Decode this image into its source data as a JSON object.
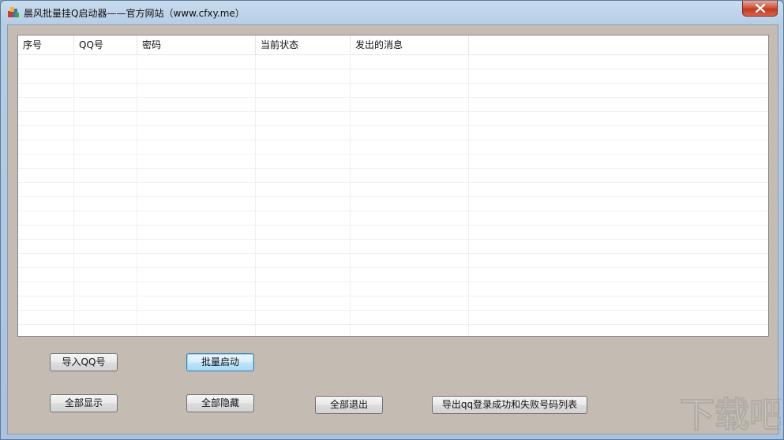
{
  "window": {
    "title": "晨风批量挂Q启动器——官方网站（www.cfxy.me）",
    "colors": {
      "client_bg": "#c4bcb2",
      "close_red": "#c23a20"
    }
  },
  "listview": {
    "columns": [
      "序号",
      "QQ号",
      "密码",
      "当前状态",
      "发出的消息",
      ""
    ],
    "rows": []
  },
  "buttons": {
    "import_qq": "导入QQ号",
    "batch_start": "批量启动",
    "show_all": "全部显示",
    "hide_all": "全部隐藏",
    "exit_all": "全部退出",
    "export_list": "导出qq登录成功和失败号码列表"
  },
  "icons": {
    "app": "app-logo-icon",
    "close": "close-icon"
  },
  "watermark": {
    "label": "下载吧"
  }
}
